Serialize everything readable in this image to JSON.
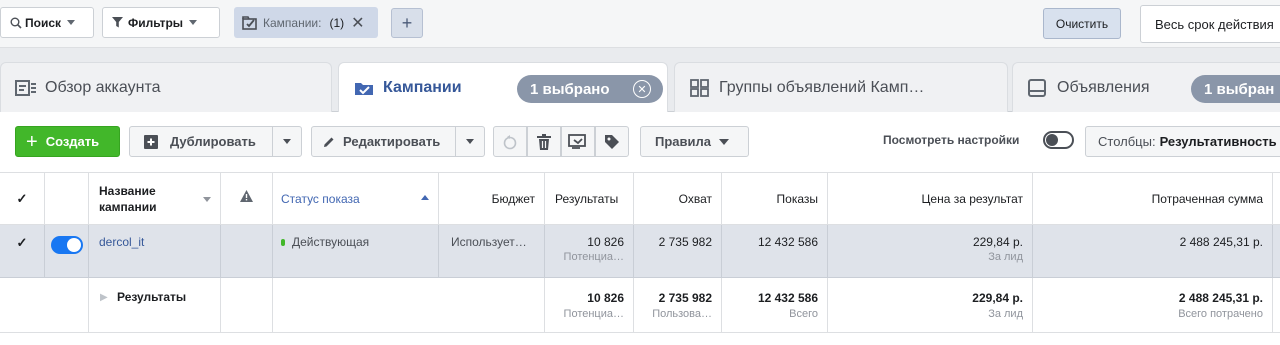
{
  "filterbar": {
    "search_label": "Поиск",
    "filters_label": "Фильтры",
    "chip_label": "Кампании:",
    "chip_count": "(1)",
    "add_label": "+",
    "clear_label": "Очистить",
    "period_label": "Весь срок действия"
  },
  "tabs": {
    "account": "Обзор аккаунта",
    "campaigns": "Кампании",
    "campaigns_badge": "1 выбрано",
    "adsets": "Группы объявлений Камп…",
    "ads": "Объявления",
    "ads_badge": "1 выбран"
  },
  "toolbar": {
    "create_label": "Создать",
    "duplicate_label": "Дублировать",
    "edit_label": "Редактировать",
    "rules_label": "Правила",
    "view_settings_label": "Посмотреть настройки",
    "columns_label": "Столбцы:",
    "columns_value": "Результативность"
  },
  "table": {
    "headers": {
      "name": "Название кампании",
      "status": "Статус показа",
      "budget": "Бюджет",
      "results": "Результаты",
      "reach": "Охват",
      "impressions": "Показы",
      "cost_per_result": "Цена за результат",
      "amount_spent": "Потраченная сумма"
    },
    "row": {
      "name": "dercol_it",
      "status": "Действующая",
      "budget": "Использует…",
      "results": "10 826",
      "results_sub": "Потенциа…",
      "reach": "2 735 982",
      "impressions": "12 432 586",
      "cost": "229,84 р.",
      "cost_sub": "За лид",
      "spent": "2 488 245,31 р."
    },
    "summary": {
      "label": "Результаты",
      "results": "10 826",
      "results_sub": "Потенциа…",
      "reach": "2 735 982",
      "reach_sub": "Пользова…",
      "impressions": "12 432 586",
      "impressions_sub": "Всего",
      "cost": "229,84 р.",
      "cost_sub": "За лид",
      "spent": "2 488 245,31 р.",
      "spent_sub": "Всего потрачено"
    }
  },
  "colors": {
    "create_green": "#42b72a",
    "link_blue": "#365899",
    "toggle_blue": "#1877f2",
    "status_green": "#42b72a",
    "badge_gray": "#8a96a9"
  }
}
